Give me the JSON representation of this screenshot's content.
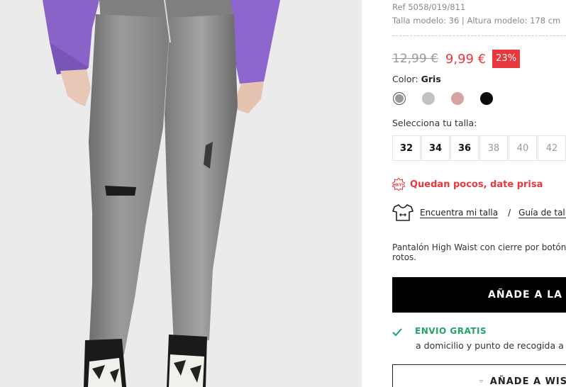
{
  "product": {
    "ref": "Ref 5058/019/811",
    "model_info": "Talla modelo: 36 | Altura modelo: 178 cm",
    "old_price": "12,99 €",
    "new_price": "9,99 €",
    "discount": "23%",
    "color_prefix": "Color: ",
    "color_name": "Gris",
    "swatches": [
      {
        "name": "gris",
        "color": "#9a9a9a",
        "selected": true
      },
      {
        "name": "gris-claro",
        "color": "#c2c2c2",
        "selected": false
      },
      {
        "name": "rosa",
        "color": "#d6a3a3",
        "selected": false
      },
      {
        "name": "negro",
        "color": "#0b0b0b",
        "selected": false
      }
    ],
    "size_label": "Selecciona tu talla:",
    "sizes": [
      {
        "label": "32",
        "available": true
      },
      {
        "label": "34",
        "available": true
      },
      {
        "label": "36",
        "available": true
      },
      {
        "label": "38",
        "available": false
      },
      {
        "label": "40",
        "available": false
      },
      {
        "label": "42",
        "available": false
      }
    ],
    "hurry_badge": "HEY!",
    "hurry_text": "Quedan pocos, date prisa",
    "find_size": "Encuentra mi talla",
    "separator": "/",
    "size_guide": "Guía de talla",
    "description_line1": "Pantalón High Waist con cierre por botón y",
    "description_line2": "rotos.",
    "add_to_cart": "AÑADE A LA CES",
    "shipping_title": "ENVIO GRATIS",
    "shipping_sub": "a domicilio y punto de recogida a p",
    "wishlist": "AÑADE A WISH"
  },
  "icons": {
    "hanger": "tshirt-size-icon",
    "check": "check-icon",
    "heart": "heart-icon",
    "hurry": "hey-badge-icon"
  },
  "colors": {
    "accent_red": "#e8383d",
    "green": "#22a36a",
    "button_black": "#000000"
  }
}
